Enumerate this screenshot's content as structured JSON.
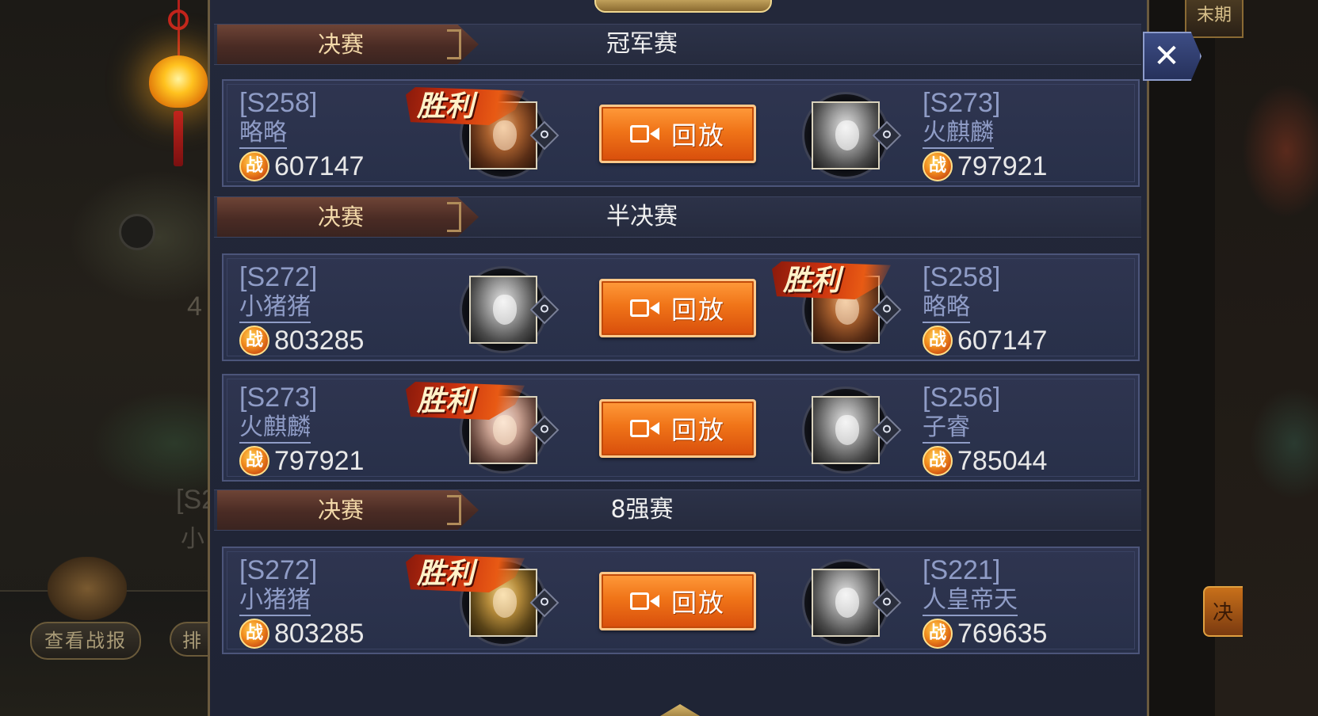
{
  "background": {
    "left_text_1": "4",
    "left_text_2": "[S2",
    "left_text_3": "小",
    "view_report_button": "查看战报",
    "rank_button": "排",
    "top_right_button": "末期",
    "bottom_right_button": "决"
  },
  "close_label": "✕",
  "power_icon_label": "战",
  "replay_label": "回放",
  "victory_label": "胜利",
  "sections": [
    {
      "tag": "决赛",
      "round": "冠军赛",
      "matches": [
        {
          "winner": "left",
          "left": {
            "server": "[S258]",
            "name": "略略",
            "power": "607147",
            "avatar": "win"
          },
          "right": {
            "server": "[S273]",
            "name": "火麒麟",
            "power": "797921",
            "avatar": "lose"
          }
        }
      ]
    },
    {
      "tag": "决赛",
      "round": "半决赛",
      "matches": [
        {
          "winner": "right",
          "left": {
            "server": "[S272]",
            "name": "小猪猪",
            "power": "803285",
            "avatar": "lose"
          },
          "right": {
            "server": "[S258]",
            "name": "略略",
            "power": "607147",
            "avatar": "win"
          }
        },
        {
          "winner": "left",
          "left": {
            "server": "[S273]",
            "name": "火麒麟",
            "power": "797921",
            "avatar": "win"
          },
          "right": {
            "server": "[S256]",
            "name": "子睿",
            "power": "785044",
            "avatar": "lose"
          }
        }
      ]
    },
    {
      "tag": "决赛",
      "round": "8强赛",
      "matches": [
        {
          "winner": "left",
          "left": {
            "server": "[S272]",
            "name": "小猪猪",
            "power": "803285",
            "avatar": "win"
          },
          "right": {
            "server": "[S221]",
            "name": "人皇帝天",
            "power": "769635",
            "avatar": "lose"
          }
        }
      ]
    }
  ]
}
